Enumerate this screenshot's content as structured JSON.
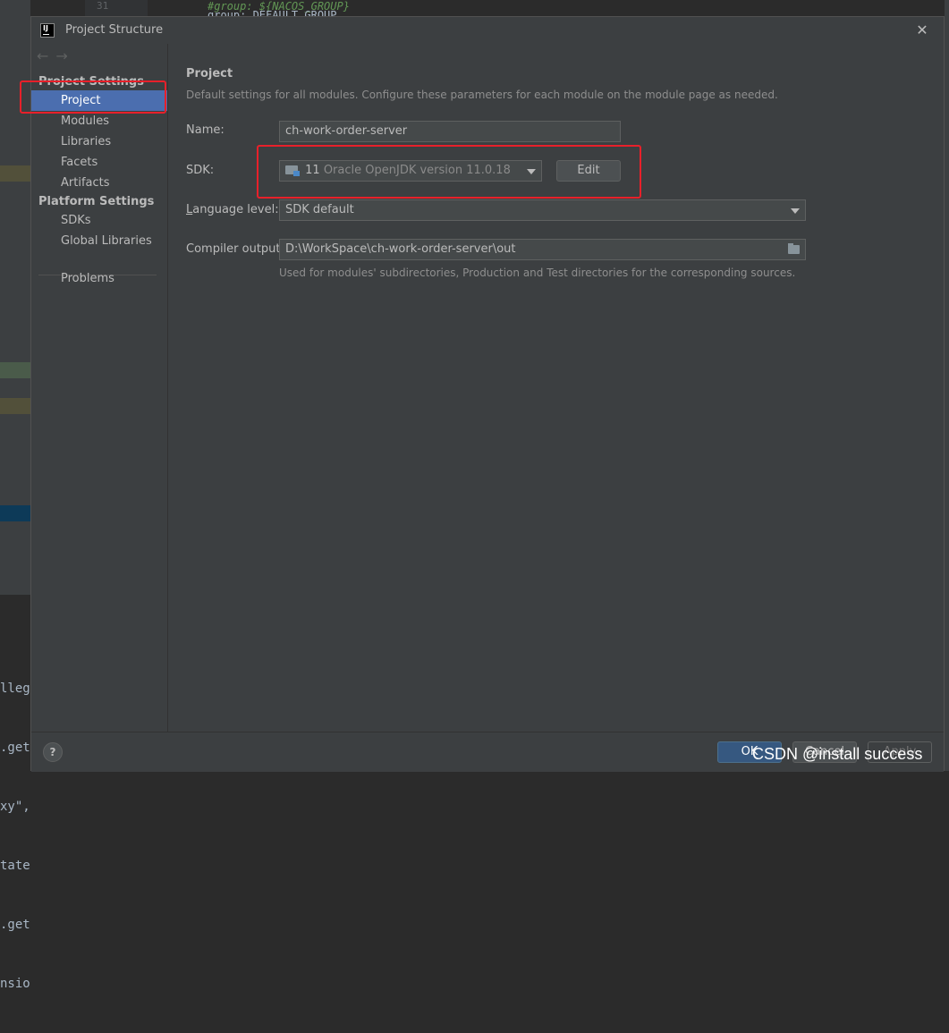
{
  "background": {
    "line_number": "31",
    "code_line_1": "#group: ${NACOS_GROUP}",
    "code_line_2": "group: DEFAULT_GROUP",
    "console_lines": [
      "lleg",
      ".get",
      "xy\",",
      "tate",
      ".get",
      "nsio"
    ]
  },
  "dialog": {
    "title": "Project Structure",
    "app_icon_text": "IJ"
  },
  "sidebar": {
    "project_settings_header": "Project Settings",
    "project_settings_items": [
      {
        "label": "Project",
        "selected": true
      },
      {
        "label": "Modules"
      },
      {
        "label": "Libraries"
      },
      {
        "label": "Facets"
      },
      {
        "label": "Artifacts"
      }
    ],
    "platform_settings_header": "Platform Settings",
    "platform_settings_items": [
      {
        "label": "SDKs"
      },
      {
        "label": "Global Libraries"
      }
    ],
    "problems_label": "Problems"
  },
  "content": {
    "title": "Project",
    "description": "Default settings for all modules. Configure these parameters for each module on the module page as needed.",
    "name_label": "Name:",
    "name_value": "ch-work-order-server",
    "sdk_label": "SDK:",
    "sdk_version": "11",
    "sdk_name": "Oracle OpenJDK version 11.0.18",
    "edit_button": "Edit",
    "language_level_label_underlined": "L",
    "language_level_label_rest": "anguage level:",
    "language_level_value": "SDK default",
    "compiler_output_label": "Compiler output:",
    "compiler_output_value": "D:\\WorkSpace\\ch-work-order-server\\out",
    "compiler_output_hint": "Used for modules' subdirectories, Production and Test directories for the corresponding sources."
  },
  "footer": {
    "help_label": "?",
    "ok_label": "OK",
    "cancel_label": "Cancel",
    "apply_label": "Apply"
  },
  "colors": {
    "selection": "#4b6eaf",
    "highlight_box": "#e8202a",
    "ok_button": "#365880"
  },
  "watermark": "CSDN @install success"
}
